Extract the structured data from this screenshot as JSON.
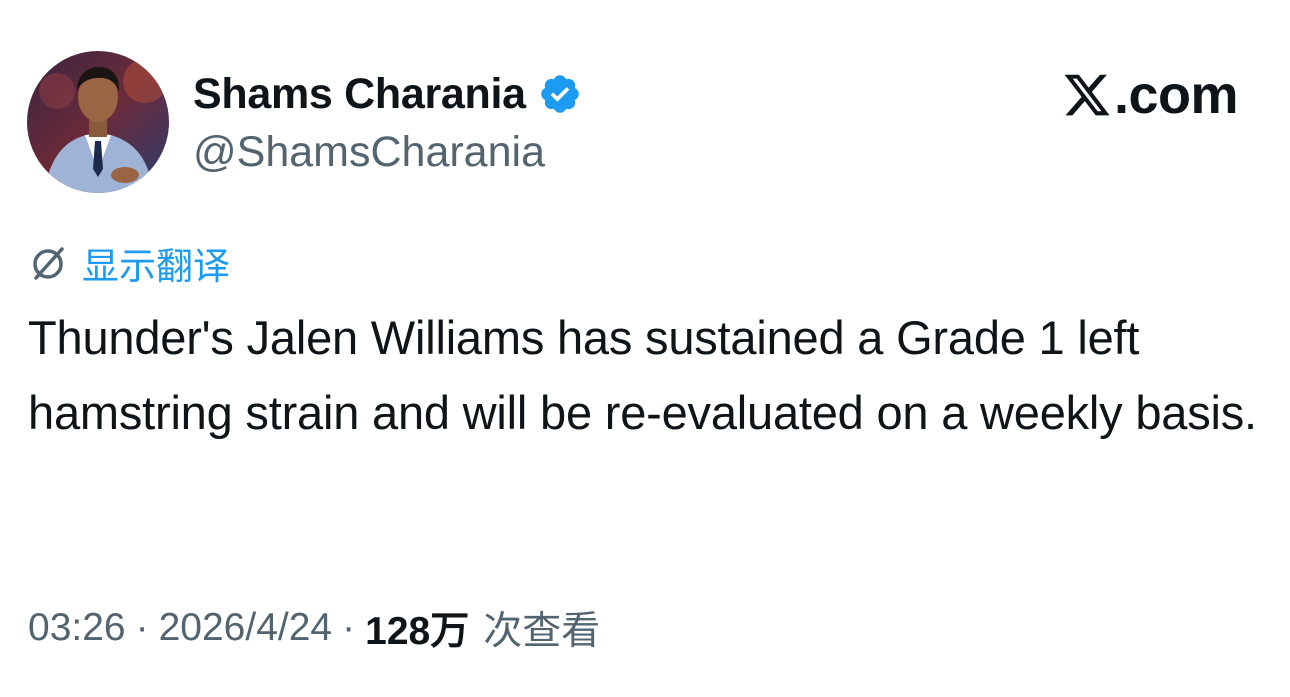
{
  "author": {
    "display_name": "Shams Charania",
    "handle": "@ShamsCharania",
    "verified": true,
    "avatar": "avatar-photo"
  },
  "brand": {
    "icon": "x-logo-icon",
    "text": ".com"
  },
  "translate": {
    "icon": "translate-icon",
    "label": "显示翻译"
  },
  "tweet": {
    "text": "Thunder's Jalen Williams has sustained a Grade 1 left hamstring strain and will be re-evaluated on a weekly basis."
  },
  "meta": {
    "time": "03:26",
    "separator": "·",
    "date": "2026/4/24",
    "views_count": "128万",
    "views_label": "次查看"
  },
  "colors": {
    "text": "#0f1419",
    "secondary": "#536471",
    "link": "#1d9bf0",
    "verified": "#1d9bf0"
  }
}
